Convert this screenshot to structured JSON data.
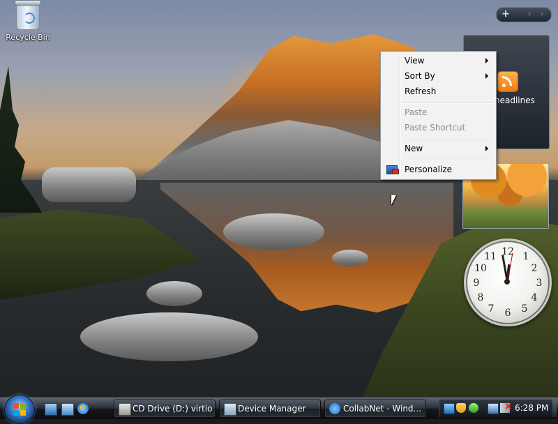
{
  "desktop": {
    "icons": [
      {
        "label": "Recycle Bin",
        "icon": "recycle-bin-icon"
      }
    ]
  },
  "sidebar": {
    "controls": {
      "add": "+",
      "prev": "‹",
      "next": "›"
    },
    "gadgets": {
      "feed": {
        "title": "headlines",
        "icon": "rss-icon"
      },
      "slideshow": {
        "icon": "slideshow-image"
      },
      "clock": {
        "numbers": [
          "12",
          "1",
          "2",
          "3",
          "4",
          "5",
          "6",
          "7",
          "8",
          "9",
          "10",
          "11"
        ],
        "time_hour": 6,
        "time_minute": 28
      }
    }
  },
  "context_menu": {
    "items": [
      {
        "label": "View",
        "submenu": true,
        "enabled": true
      },
      {
        "label": "Sort By",
        "submenu": true,
        "enabled": true
      },
      {
        "label": "Refresh",
        "submenu": false,
        "enabled": true
      },
      {
        "label": "Paste",
        "submenu": false,
        "enabled": false
      },
      {
        "label": "Paste Shortcut",
        "submenu": false,
        "enabled": false
      },
      {
        "label": "New",
        "submenu": true,
        "enabled": true
      },
      {
        "label": "Personalize",
        "submenu": false,
        "enabled": true,
        "icon": "personalize-icon"
      }
    ]
  },
  "taskbar": {
    "start": {
      "icon": "windows-logo-icon"
    },
    "quick_launch": [
      {
        "icon": "show-desktop-icon"
      },
      {
        "icon": "switch-windows-icon"
      },
      {
        "icon": "internet-explorer-icon"
      }
    ],
    "tasks": [
      {
        "label": "CD Drive (D:) virtio...",
        "icon": "cd-drive-icon"
      },
      {
        "label": "Device Manager",
        "icon": "device-manager-icon"
      },
      {
        "label": "CollabNet - Wind...",
        "icon": "internet-explorer-icon"
      }
    ],
    "tray": {
      "icons": [
        "network-icon",
        "security-shield-icon",
        "windows-update-icon",
        "monitor-icon",
        "volume-muted-icon"
      ],
      "clock": "6:28 PM"
    }
  }
}
